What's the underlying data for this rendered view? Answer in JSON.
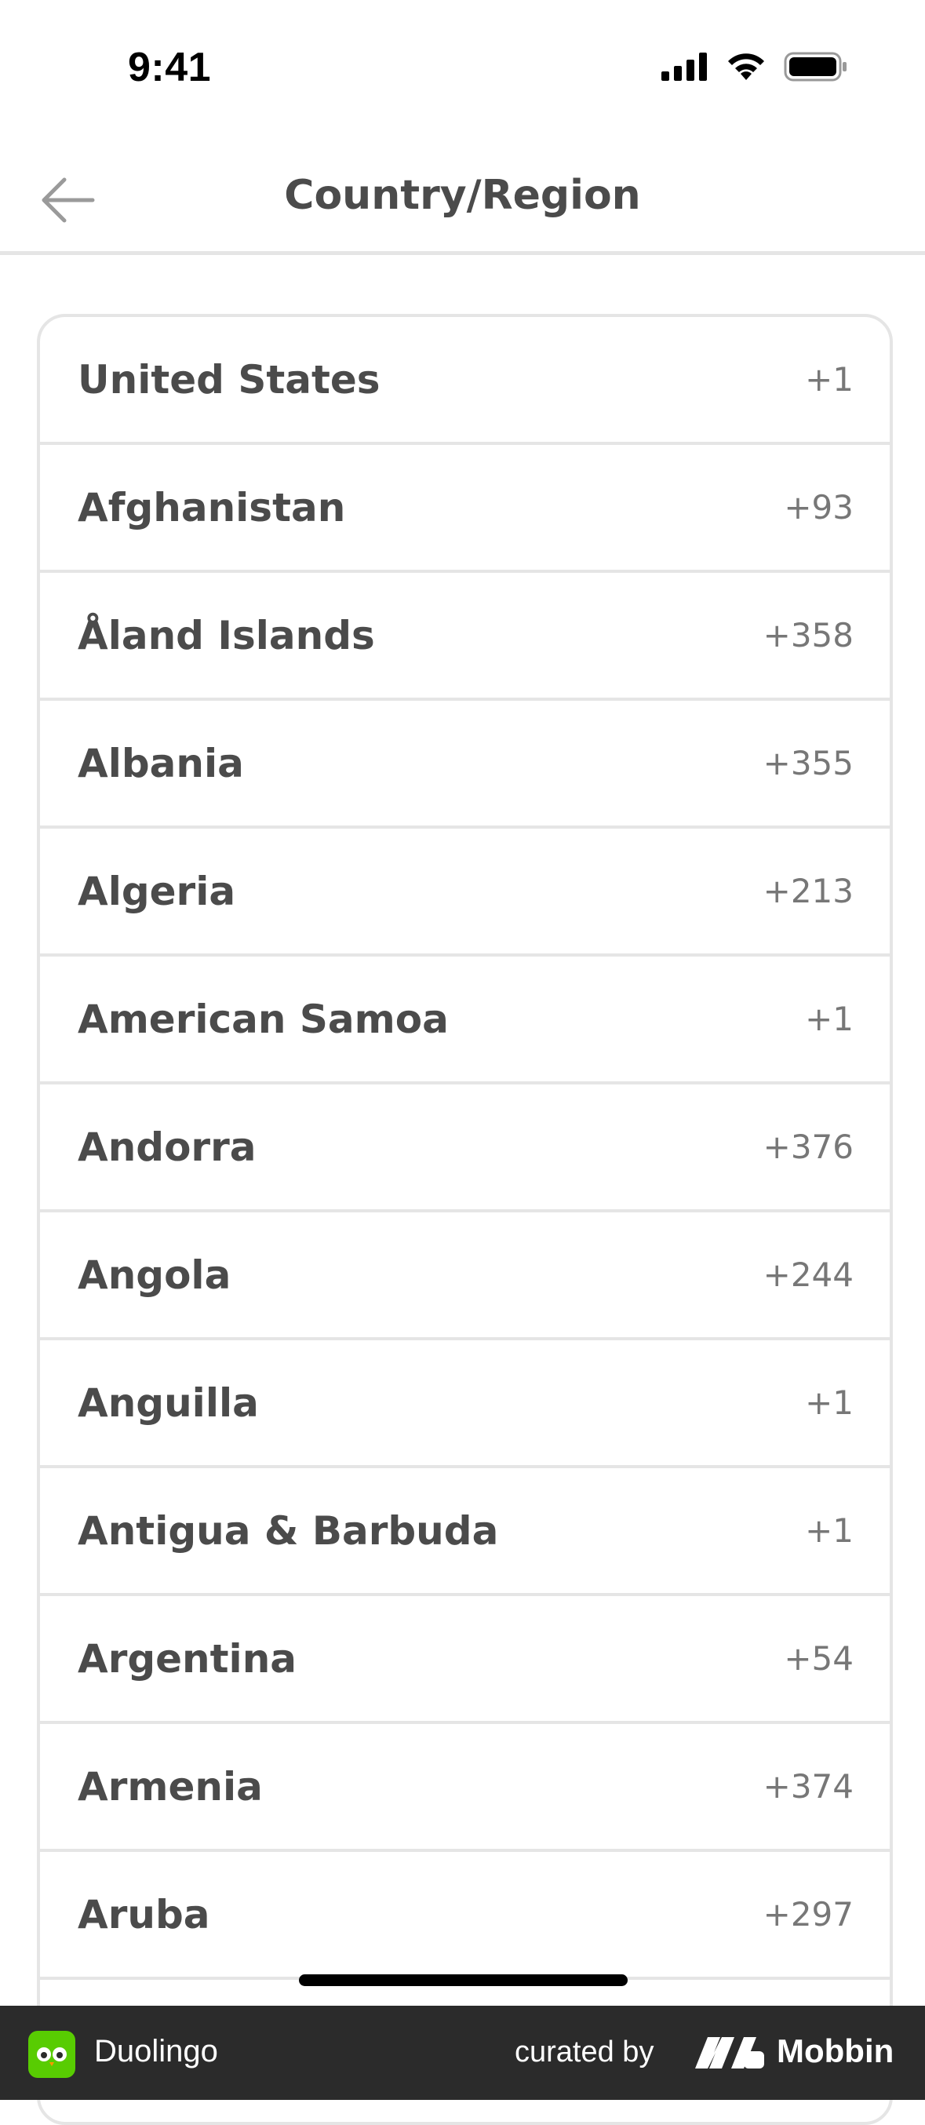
{
  "status_bar": {
    "time": "9:41",
    "icons": [
      "signal-icon",
      "wifi-icon",
      "battery-icon"
    ]
  },
  "header": {
    "back_icon": "arrow-left-icon",
    "title": "Country/Region"
  },
  "countries": [
    {
      "name": "United States",
      "code": "+1"
    },
    {
      "name": "Afghanistan",
      "code": "+93"
    },
    {
      "name": "Åland Islands",
      "code": "+358"
    },
    {
      "name": "Albania",
      "code": "+355"
    },
    {
      "name": "Algeria",
      "code": "+213"
    },
    {
      "name": "American Samoa",
      "code": "+1"
    },
    {
      "name": "Andorra",
      "code": "+376"
    },
    {
      "name": "Angola",
      "code": "+244"
    },
    {
      "name": "Anguilla",
      "code": "+1"
    },
    {
      "name": "Antigua & Barbuda",
      "code": "+1"
    },
    {
      "name": "Argentina",
      "code": "+54"
    },
    {
      "name": "Armenia",
      "code": "+374"
    },
    {
      "name": "Aruba",
      "code": "+297"
    }
  ],
  "footer": {
    "app_name": "Duolingo",
    "curated_by": "curated by",
    "brand": "Mobbin"
  },
  "colors": {
    "text": "#4b4b4b",
    "code_text": "#777777",
    "border": "#e5e5e5",
    "footer_bg": "#2b2b2b",
    "duolingo_green": "#58cc02"
  }
}
